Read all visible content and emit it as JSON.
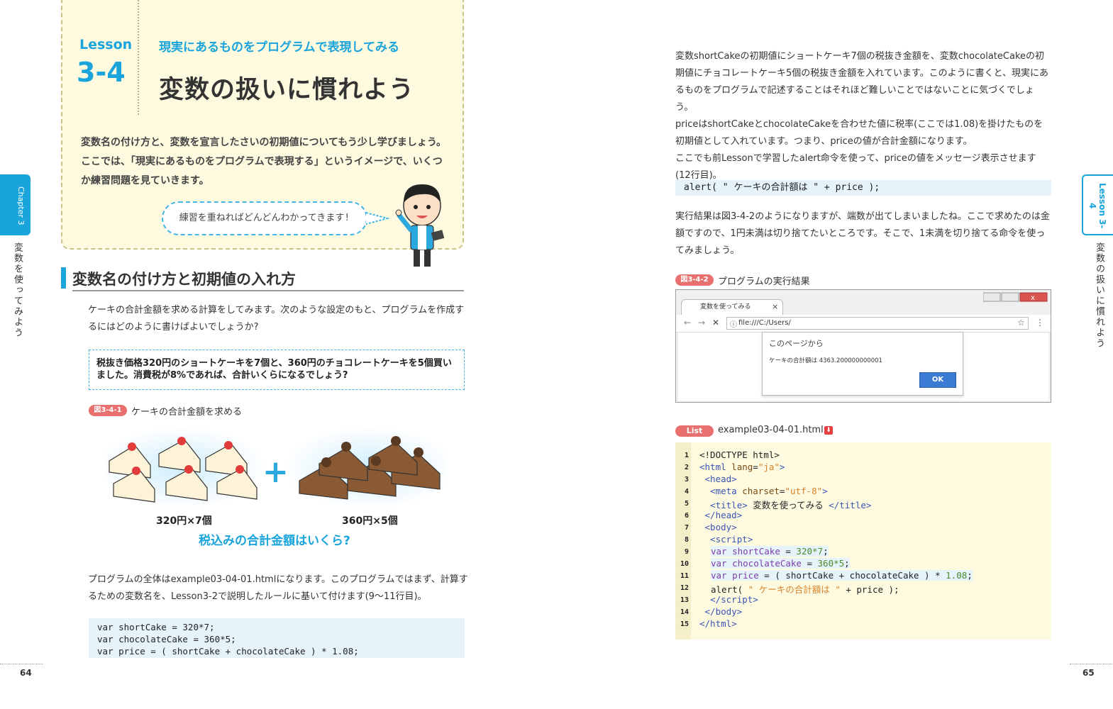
{
  "lesson": {
    "label": "Lesson",
    "number": "3-4",
    "subtitle": "現実にあるものをプログラムで表現してみる",
    "title": "変数の扱いに慣れよう",
    "intro": "変数名の付け方と、変数を宣言したさいの初期値についてもう少し学びましょう。ここでは、「現実にあるものをプログラムで表現する」というイメージで、いくつか練習問題を見ていきます。",
    "bubble": "練習を重ねればどんどんわかってきます!"
  },
  "side": {
    "left_tab": "Chapter 3",
    "left_vertical": "変数を使ってみよう",
    "right_tab": "Lesson 3-4",
    "right_vertical": "変数の扱いに慣れよう"
  },
  "left_page": {
    "section_title": "変数名の付け方と初期値の入れ方",
    "para1": "ケーキの合計金額を求める計算をしてみます。次のような設定のもと、プログラムを作成するにはどのように書けばよいでしょうか?",
    "question": "税抜き価格320円のショートケーキを7個と、360円のチョコレートケーキを5個買いました。消費税が8%であれば、合計いくらになるでしょう?",
    "fig1_badge": "図3-4-1",
    "fig1_caption": "ケーキの合計金額を求める",
    "cake1_label": "320円×7個",
    "cake2_label": "360円×5個",
    "cake_question": "税込みの合計金額はいくら?",
    "plus": "+",
    "para2": "プログラムの全体はexample03-04-01.htmlになります。このプログラムではまず、計算するための変数名を、Lesson3-2で説明したルールに基いて付けます(9〜11行目)。",
    "code": [
      "var shortCake = 320*7;",
      "var chocolateCake = 360*5;",
      "var price = ( shortCake + chocolateCake ) * 1.08;"
    ],
    "page_number": "64"
  },
  "right_page": {
    "para1": "変数shortCakeの初期値にショートケーキ7個の税抜き金額を、変数chocolateCakeの初期値にチョコレートケーキ5個の税抜き金額を入れています。このように書くと、現実にあるものをプログラムで記述することはそれほど難しいことではないことに気づくでしょう。",
    "para2": "priceはshortCakeとchocolateCakeを合わせた値に税率(ここでは1.08)を掛けたものを初期値として入れています。つまり、priceの値が合計金額になります。",
    "para3": "ここでも前Lessonで学習したalert命令を使って、priceの値をメッセージ表示させます(12行目)。",
    "code_line": "alert( \" ケーキの合計額は \" + price );",
    "para4": "実行結果は図3-4-2のようになりますが、端数が出てしまいましたね。ここで求めたのは金額ですので、1円未満は切り捨てたいところです。そこで、1未満を切り捨てる命令を使ってみましょう。",
    "fig2_badge": "図3-4-2",
    "fig2_caption": "プログラムの実行結果",
    "browser": {
      "tab_title": "変数を使ってみる",
      "tab_close": "×",
      "url": "file:///C:/Users/",
      "dialog_title": "このページから",
      "dialog_message": "ケーキの合計額は 4363.200000000001",
      "ok_label": "OK"
    },
    "list_badge": "List",
    "list_file": "example03-04-01.html",
    "page_number": "65"
  }
}
